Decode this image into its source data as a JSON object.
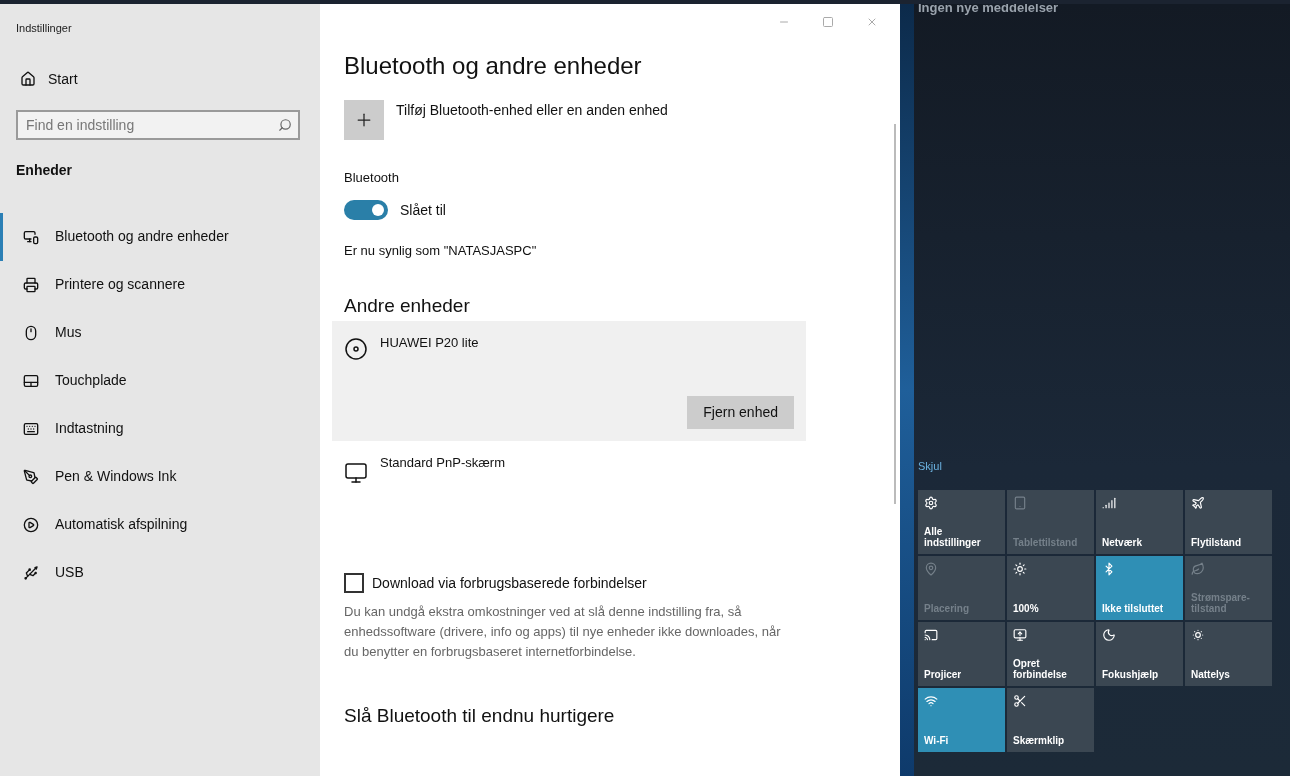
{
  "window": {
    "title": "Indstillinger"
  },
  "sidebar": {
    "home": "Start",
    "search": {
      "placeholder": "Find en indstilling"
    },
    "section": "Enheder",
    "items": [
      {
        "label": "Bluetooth og andre enheder",
        "selected": true
      },
      {
        "label": "Printere og scannere",
        "selected": false
      },
      {
        "label": "Mus",
        "selected": false
      },
      {
        "label": "Touchplade",
        "selected": false
      },
      {
        "label": "Indtastning",
        "selected": false
      },
      {
        "label": "Pen & Windows Ink",
        "selected": false
      },
      {
        "label": "Automatisk afspilning",
        "selected": false
      },
      {
        "label": "USB",
        "selected": false
      }
    ]
  },
  "main": {
    "title": "Bluetooth og andre enheder",
    "add_device": "Tilføj Bluetooth-enhed eller en anden enhed",
    "bluetooth": {
      "label": "Bluetooth",
      "on": true,
      "state": "Slået til"
    },
    "visible_as": "Er nu synlig som \"NATASJASPC\"",
    "other_heading": "Andre enheder",
    "devices": [
      {
        "name": "HUAWEI P20 lite",
        "selected": true,
        "action": "Fjern enhed"
      },
      {
        "name": "Standard PnP-skærm",
        "selected": false
      }
    ],
    "metered": {
      "label": "Download via forbrugsbaserede forbindelser",
      "checked": false,
      "description": "Du kan undgå ekstra omkostninger ved at slå denne indstilling fra, så enhedssoftware (drivere, info og apps) til nye enheder ikke downloades, når du benytter en forbrugsbaseret internetforbindelse."
    },
    "bottom_heading": "Slå Bluetooth til endnu hurtigere"
  },
  "action_center": {
    "notifications": "Ingen nye meddelelser",
    "collapse": "Skjul",
    "tiles": [
      {
        "label": "Alle indstillinger",
        "on": false,
        "disabled": false
      },
      {
        "label": "Tablettilstand",
        "on": false,
        "disabled": true
      },
      {
        "label": "Netværk",
        "on": false,
        "disabled": false
      },
      {
        "label": "Flytilstand",
        "on": false,
        "disabled": false
      },
      {
        "label": "Placering",
        "on": false,
        "disabled": true
      },
      {
        "label": "100%",
        "on": false,
        "disabled": false
      },
      {
        "label": "Ikke tilsluttet",
        "on": true,
        "disabled": false
      },
      {
        "label": "Strømspare-tilstand",
        "on": false,
        "disabled": true
      },
      {
        "label": "Projicer",
        "on": false,
        "disabled": false
      },
      {
        "label": "Opret forbindelse",
        "on": false,
        "disabled": false
      },
      {
        "label": "Fokushjælp",
        "on": false,
        "disabled": false
      },
      {
        "label": "Nattelys",
        "on": false,
        "disabled": false
      },
      {
        "label": "Wi-Fi",
        "on": true,
        "disabled": false
      },
      {
        "label": "Skærmklip",
        "on": false,
        "disabled": false
      }
    ]
  }
}
